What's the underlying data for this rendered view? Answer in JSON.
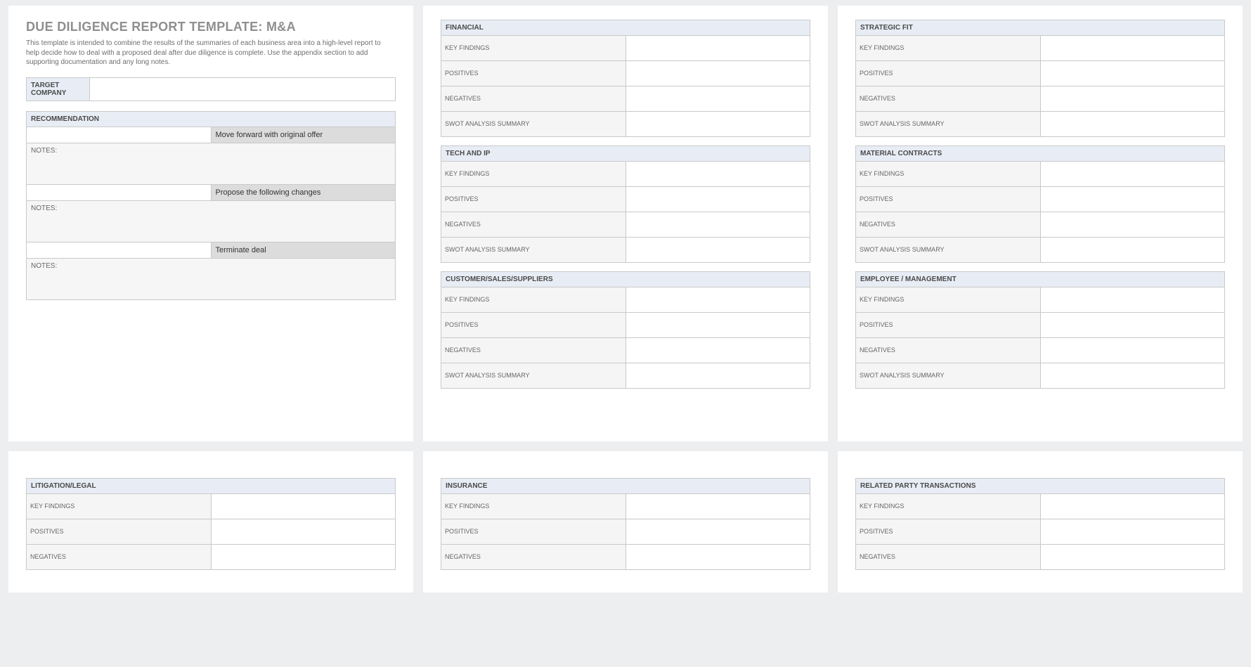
{
  "header": {
    "title": "DUE DILIGENCE REPORT TEMPLATE: M&A",
    "intro": "This template is intended to combine the results of the summaries of each business area into a high-level report to help decide how to deal with a proposed deal after due diligence is complete.  Use the appendix section to add supporting documentation and any long notes."
  },
  "target_company": {
    "label": "TARGET COMPANY",
    "value": ""
  },
  "recommendation": {
    "header": "RECOMMENDATION",
    "options": [
      {
        "label": "Move forward with original offer",
        "notes_label": "NOTES:",
        "notes": ""
      },
      {
        "label": "Propose the following changes",
        "notes_label": "NOTES:",
        "notes": ""
      },
      {
        "label": "Terminate deal",
        "notes_label": "NOTES:",
        "notes": ""
      }
    ]
  },
  "row_labels": {
    "key_findings": "KEY FINDINGS",
    "positives": "POSITIVES",
    "negatives": "NEGATIVES",
    "swot": "SWOT ANALYSIS SUMMARY"
  },
  "sections_col2": [
    {
      "title": "FINANCIAL"
    },
    {
      "title": "TECH AND IP"
    },
    {
      "title": "CUSTOMER/SALES/SUPPLIERS"
    }
  ],
  "sections_col3": [
    {
      "title": "STRATEGIC FIT"
    },
    {
      "title": "MATERIAL CONTRACTS"
    },
    {
      "title": "EMPLOYEE / MANAGEMENT"
    }
  ],
  "sections_row2": [
    {
      "title": "LITIGATION/LEGAL"
    },
    {
      "title": "INSURANCE"
    },
    {
      "title": "RELATED PARTY TRANSACTIONS"
    }
  ]
}
